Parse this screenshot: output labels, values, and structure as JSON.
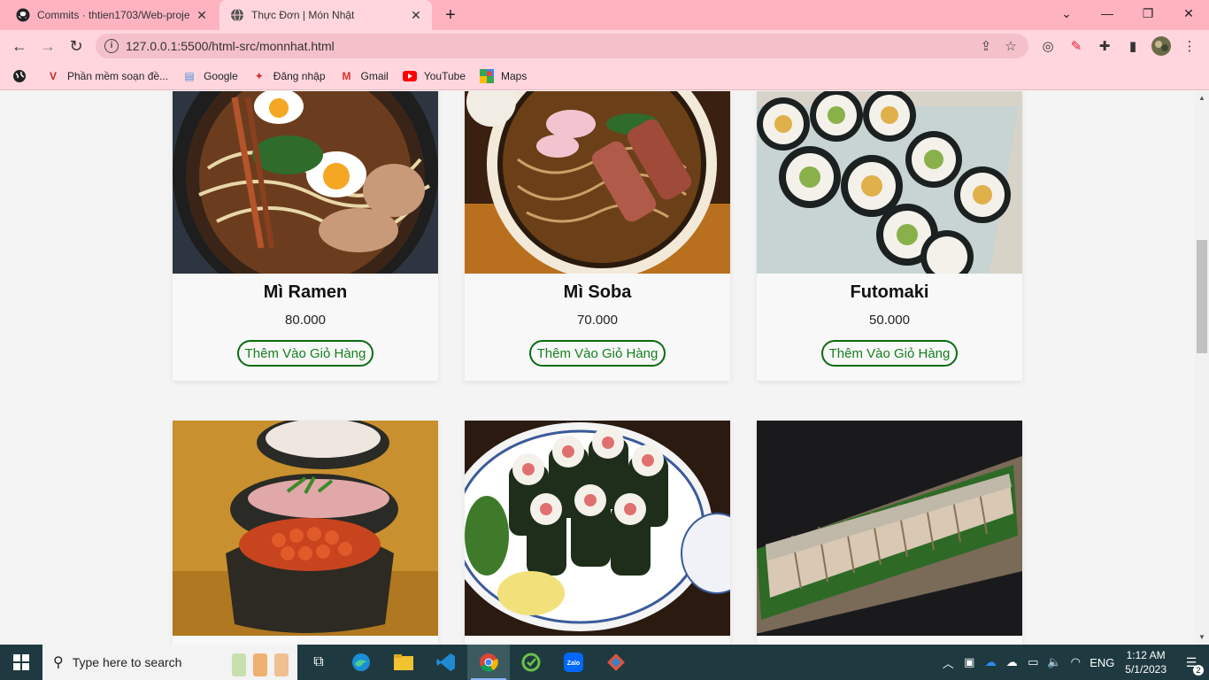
{
  "browser": {
    "tabs": [
      {
        "title": "Commits · thtien1703/Web-proje",
        "icon": "github-icon",
        "active": false
      },
      {
        "title": "Thực Đơn | Món Nhật",
        "icon": "globe-icon",
        "active": true
      }
    ],
    "url": "127.0.0.1:5500/html-src/monnhat.html",
    "bookmarks": [
      {
        "label": "Phần mềm soạn đề...",
        "icon": "v-logo-icon"
      },
      {
        "label": "Google",
        "icon": "google-icon"
      },
      {
        "label": "Đăng nhập",
        "icon": "login-icon"
      },
      {
        "label": "Gmail",
        "icon": "gmail-icon"
      },
      {
        "label": "YouTube",
        "icon": "youtube-icon"
      },
      {
        "label": "Maps",
        "icon": "maps-icon"
      }
    ]
  },
  "menu": {
    "add_to_cart_label": "Thêm Vào Giỏ Hàng",
    "items": [
      {
        "name": "Mì Ramen",
        "price": "80.000"
      },
      {
        "name": "Mì Soba",
        "price": "70.000"
      },
      {
        "name": "Futomaki",
        "price": "50.000"
      },
      {
        "name": "",
        "price": ""
      },
      {
        "name": "",
        "price": ""
      },
      {
        "name": "",
        "price": ""
      }
    ]
  },
  "taskbar": {
    "search_placeholder": "Type here to search",
    "language": "ENG",
    "time": "1:12 AM",
    "date": "5/1/2023",
    "notification_count": "2"
  },
  "colors": {
    "titlebar": "#ffb3c1",
    "toolbar": "#ffd6de",
    "button_border": "#0a6b12",
    "button_text": "#14801c",
    "taskbar": "#1e3a40"
  }
}
